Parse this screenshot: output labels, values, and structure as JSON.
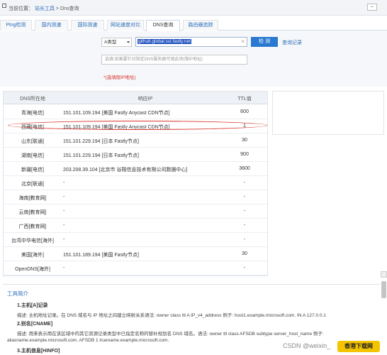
{
  "breadcrumb": {
    "prefix": "当前位置：",
    "section": "站长工具",
    "sep": ">",
    "current": "Dns查询"
  },
  "tabs": [
    {
      "label": "Ping检测"
    },
    {
      "label": "国内测速"
    },
    {
      "label": "国际测速"
    },
    {
      "label": "网站速度对比"
    },
    {
      "label": "DNS查询"
    },
    {
      "label": "路由器追踪"
    }
  ],
  "form": {
    "record_type": "A类型",
    "domain_value": "github.global.ssl.fastly.net",
    "clear_glyph": "×",
    "detect_label": "检 测",
    "query_record_label": "查询记录",
    "dns_placeholder": "选填:如果要针对指定DNS服务器可填此项(限IP地址)",
    "optional_note": "*(选填限IP地址)"
  },
  "table": {
    "columns": [
      "DNS所在地",
      "响应IP",
      "TTL值"
    ],
    "rows": [
      {
        "loc": "青海[电信]",
        "ip": "151.101.109.194 [美国 Fastly Anycast CDN节点]",
        "ttl": "600"
      },
      {
        "loc": "西藏[电信]",
        "ip": "151.101.109.194 [美国 Fastly Anycast CDN节点]",
        "ttl": "1"
      },
      {
        "loc": "山东[联通]",
        "ip": "151.101.229.194 [日本 Fastly节点]",
        "ttl": "30"
      },
      {
        "loc": "湖南[电信]",
        "ip": "151.101.229.194 [日本 Fastly节点]",
        "ttl": "900"
      },
      {
        "loc": "新疆[电信]",
        "ip": "203.208.39.104 [北京市 谷翔信息技术有限公司数据中心]",
        "ttl": "3600"
      },
      {
        "loc": "北京[联通]",
        "ip": "-",
        "ttl": "-"
      },
      {
        "loc": "海南[教育网]",
        "ip": "-",
        "ttl": "-"
      },
      {
        "loc": "云南[教育网]",
        "ip": "-",
        "ttl": "-"
      },
      {
        "loc": "广西[教育网]",
        "ip": "-",
        "ttl": "-"
      },
      {
        "loc": "台湾中华电信[海外]",
        "ip": "-",
        "ttl": "-"
      },
      {
        "loc": "美国[海外]",
        "ip": "151.101.189.194 [美国 Fastly节点]",
        "ttl": "30"
      },
      {
        "loc": "OpenDNS[海外]",
        "ip": "-",
        "ttl": "-"
      }
    ]
  },
  "tool_intro": {
    "title": "工具简介",
    "lines": [
      "1.主机[A]记录",
      "描述: 主机地址记录。在 DNS 域名与 IP 地址之间建立映射关系语法: owner class ttl A IP_v4_address 例子: host1.example.microsoft.com. IN A 127.0.0.1",
      "2.别名[CNAME]",
      "描述: 用来表示用在该区域中的其它资源记录类型中已指定名称的替补规划名 DNS 域名。语法: owner ttl class AFSDB subtype server_host_name 例子:",
      "aliasname.example.microsoft.com. AFSDB 1 truename.example.microsoft.com.",
      "3.主机信息[HINFO]"
    ]
  },
  "watermark": "CSDN @weixin_",
  "badge": "香港下载网",
  "colors": {
    "accent": "#2a79d0",
    "link": "#2a6db8",
    "highlight": "#d6332b"
  }
}
